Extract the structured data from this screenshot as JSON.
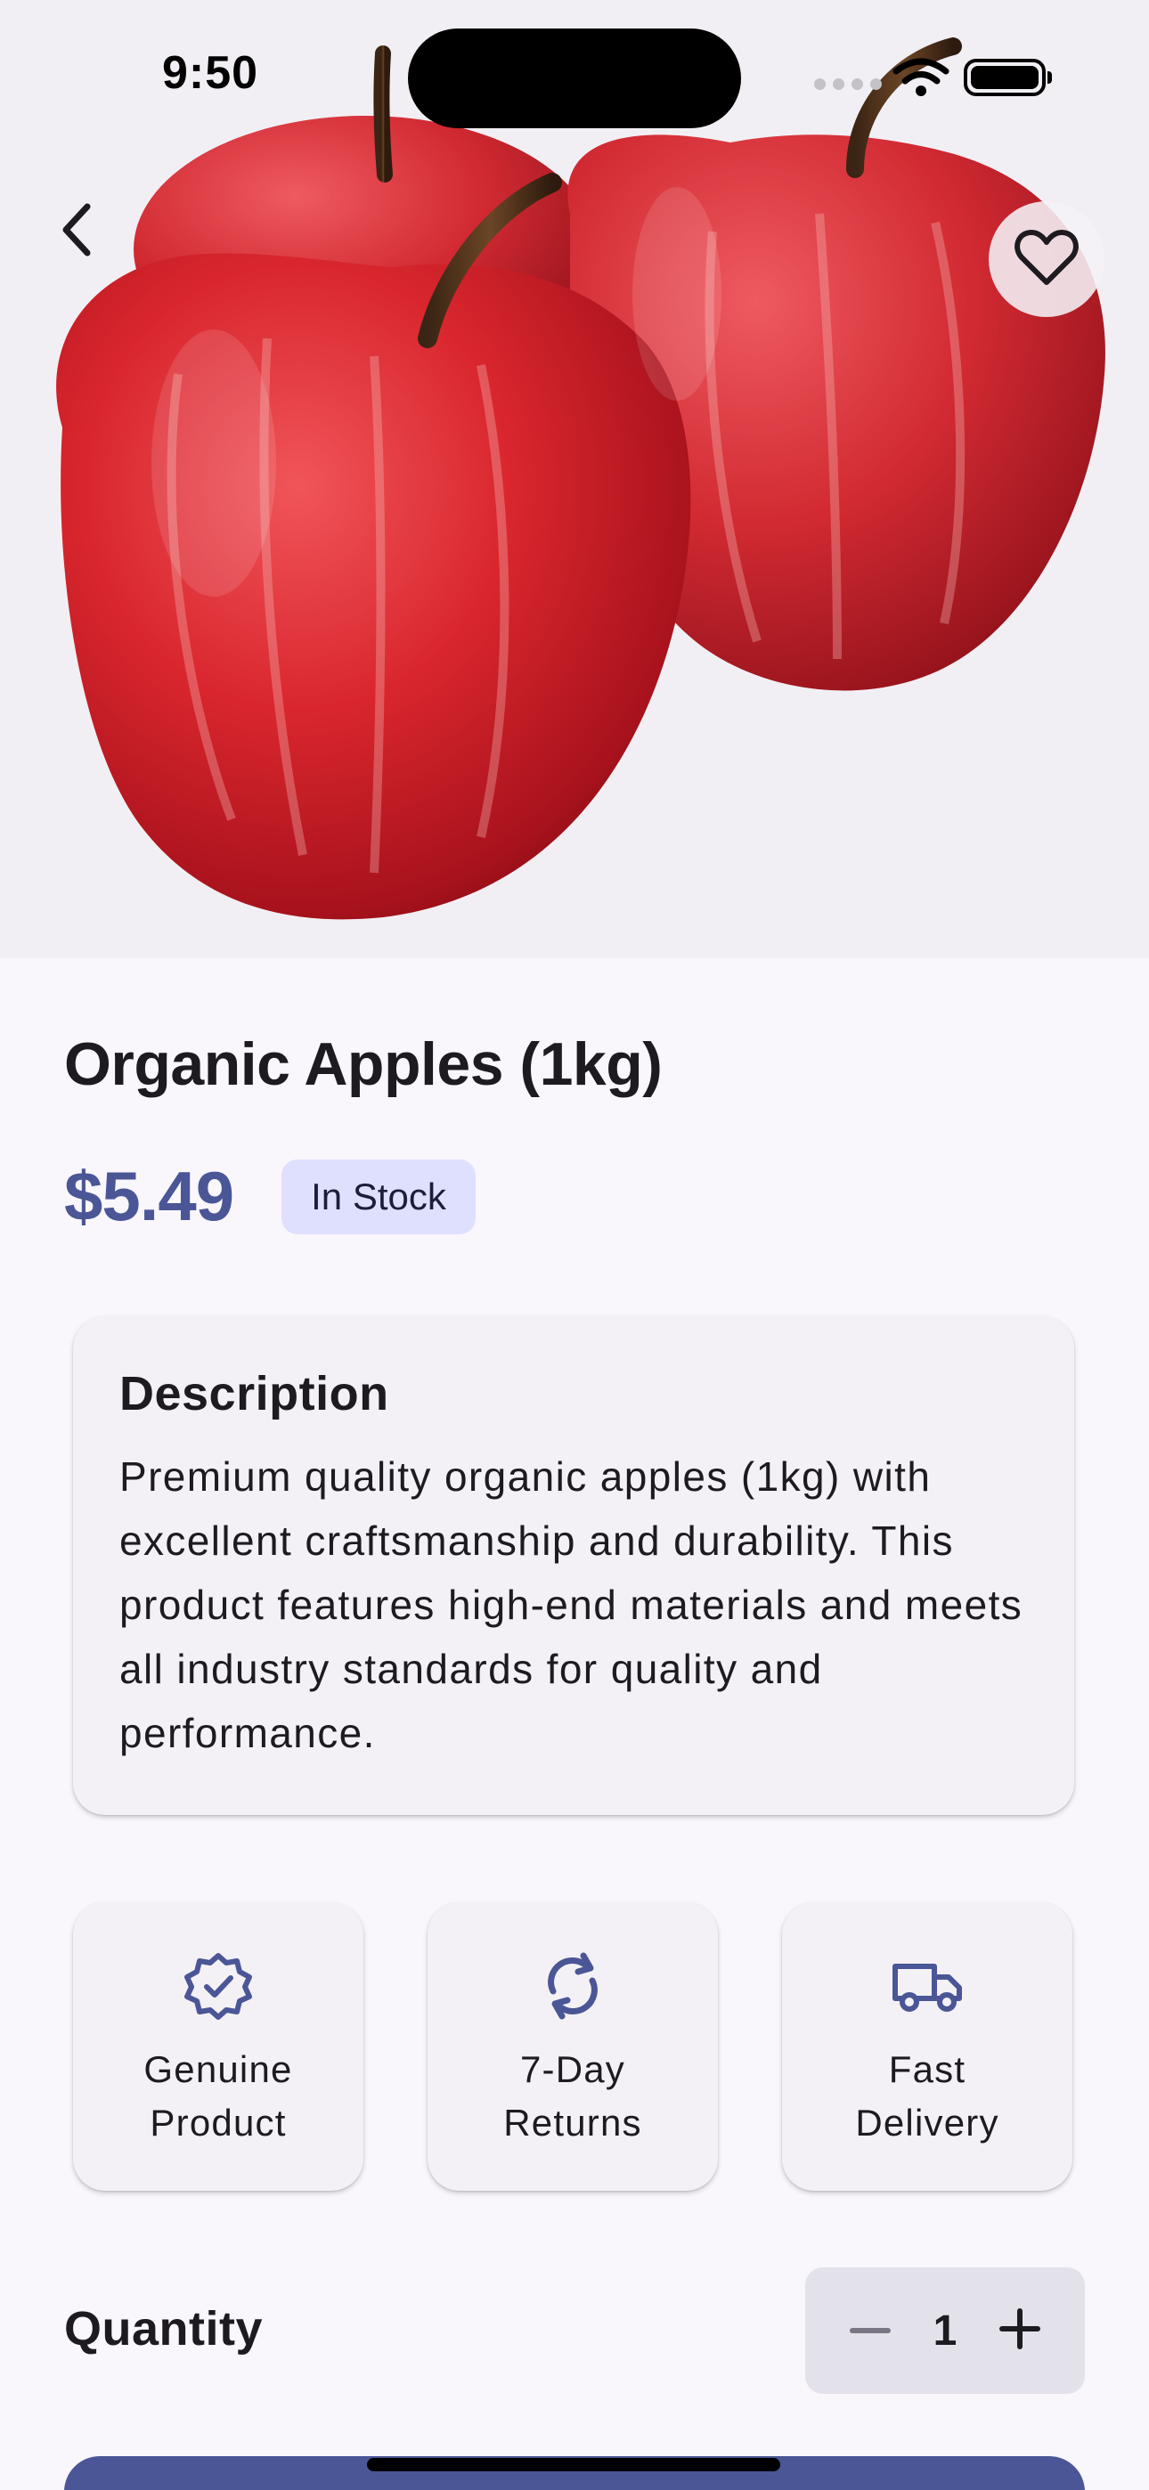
{
  "status_bar": {
    "time": "9:50"
  },
  "product": {
    "title": "Organic Apples (1kg)",
    "price": "$5.49",
    "stock_status": "In Stock",
    "image_icon": "apples-photo"
  },
  "description": {
    "heading": "Description",
    "text": "Premium quality organic apples (1kg) with excellent craftsmanship and durability. This product features high-end materials and meets all industry standards for quality and performance."
  },
  "features": [
    {
      "icon": "verified-badge-icon",
      "label": "Genuine Product"
    },
    {
      "icon": "sync-icon",
      "label": "7-Day Returns"
    },
    {
      "icon": "truck-icon",
      "label": "Fast Delivery"
    }
  ],
  "quantity": {
    "label": "Quantity",
    "value": "1"
  },
  "colors": {
    "accent": "#4a5696",
    "badge_bg": "#dfe0fe",
    "card_bg": "#f4f1f6",
    "page_bg": "#f9f6fc"
  }
}
